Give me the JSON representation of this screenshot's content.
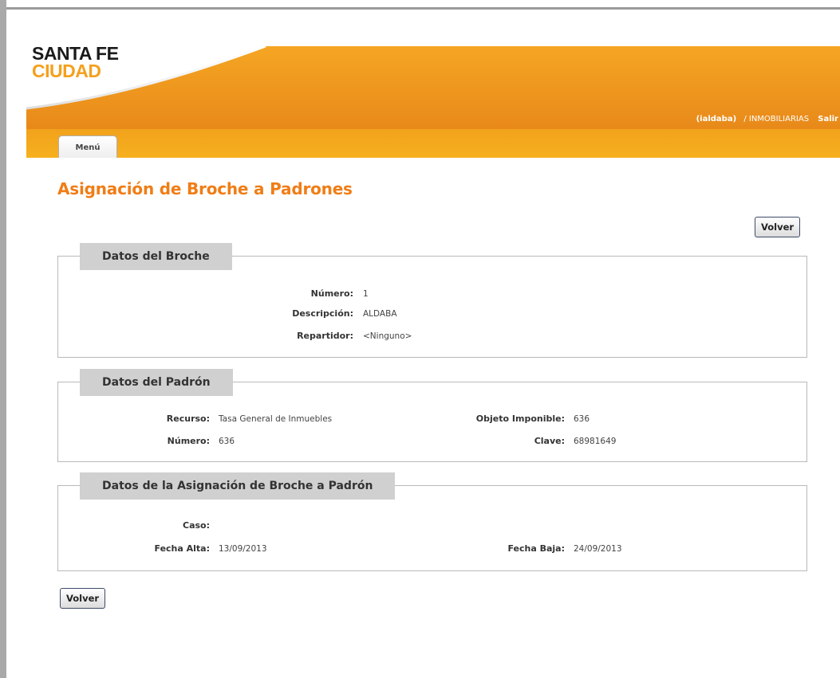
{
  "header": {
    "logo_line1": "SANTA FE",
    "logo_line2": "CIUDAD",
    "user": "(ialdaba)",
    "separator": "/ INMOBILIARIAS",
    "logout": "Salir",
    "tab_menu": "Menú"
  },
  "page_title": "Asignación de Broche a Padrones",
  "buttons": {
    "back_top": "Volver",
    "back_bottom": "Volver"
  },
  "broche": {
    "legend": "Datos del Broche",
    "numero_label": "Número:",
    "numero": "1",
    "descripcion_label": "Descripción:",
    "descripcion": "ALDABA",
    "repartidor_label": "Repartidor:",
    "repartidor": "<Ninguno>"
  },
  "padron": {
    "legend": "Datos del Padrón",
    "recurso_label": "Recurso:",
    "recurso": "Tasa General de Inmuebles",
    "objeto_label": "Objeto Imponible:",
    "objeto": "636",
    "numero_label": "Número:",
    "numero": "636",
    "clave_label": "Clave:",
    "clave": "68981649"
  },
  "asignacion": {
    "legend": "Datos de la Asignación de Broche a Padrón",
    "caso_label": "Caso:",
    "caso": "",
    "fecha_alta_label": "Fecha Alta:",
    "fecha_alta": "13/09/2013",
    "fecha_baja_label": "Fecha Baja:",
    "fecha_baja": "24/09/2013"
  },
  "colors": {
    "brand_orange": "#f07d16",
    "banner_orange": "#ec8a1a",
    "logo_yellow": "#f4a01d"
  }
}
